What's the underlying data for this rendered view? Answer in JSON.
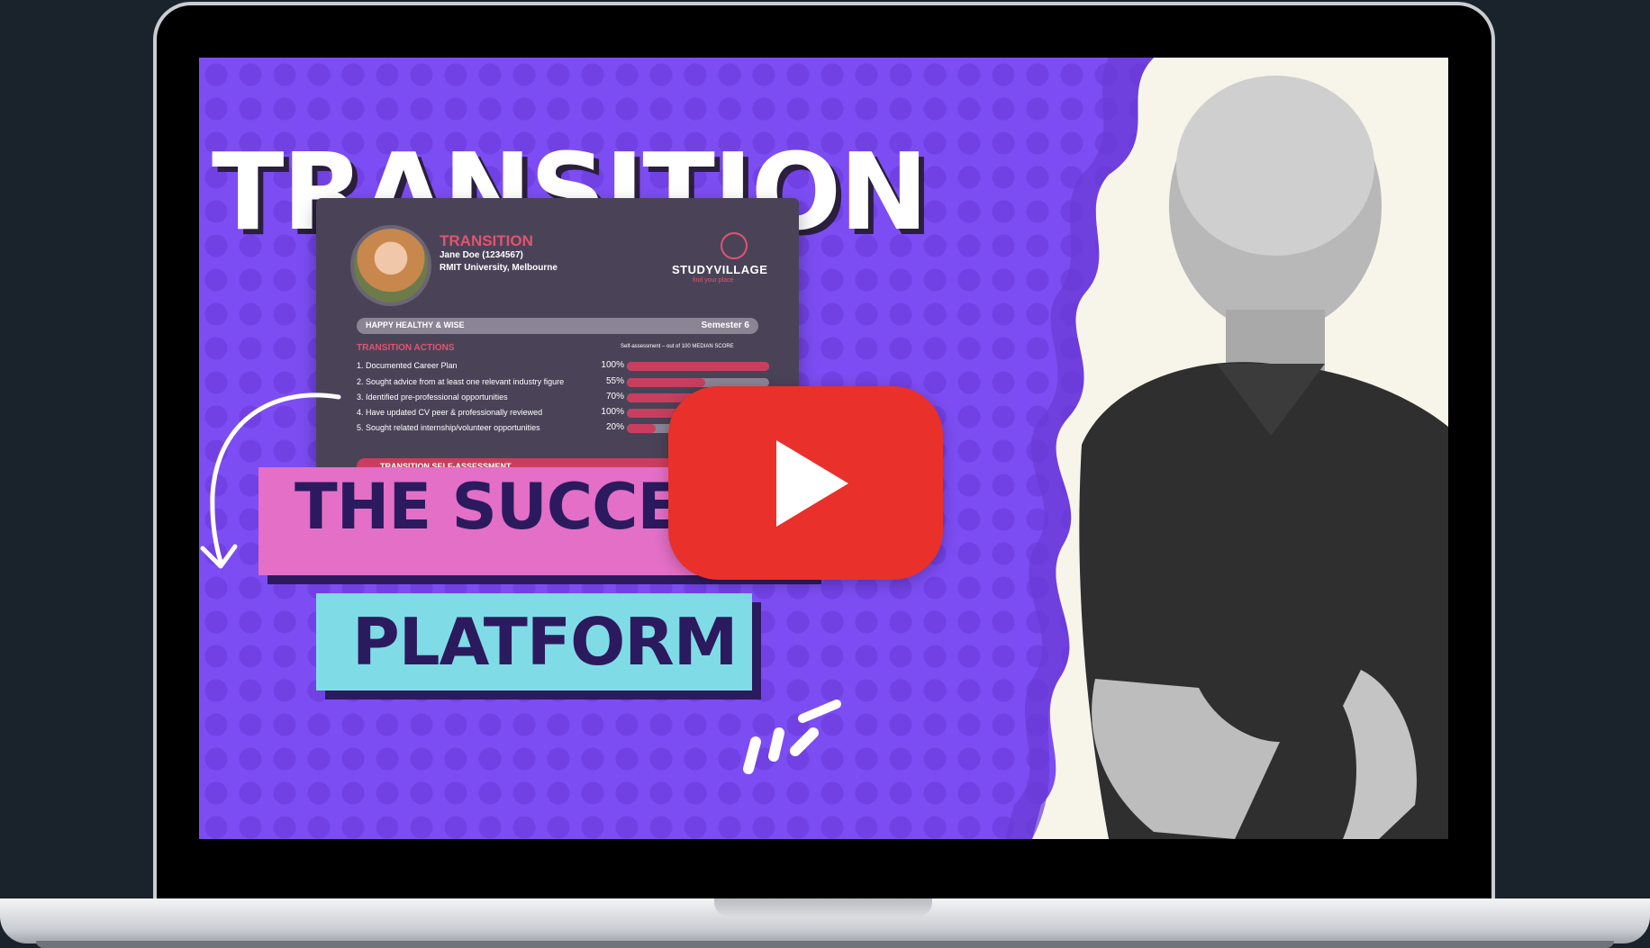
{
  "thumbnail": {
    "headline": "TRANSITION",
    "pink_label": "THE SUCCE",
    "cyan_label": "PLATFORM",
    "colors": {
      "background": "#7c4df2",
      "pink": "#e36fc7",
      "cyan": "#7fdce6",
      "dark_text": "#2c1a5e",
      "play_red": "#e9302a"
    }
  },
  "dashboard": {
    "title": "TRANSITION",
    "student_name": "Jane Doe (1234567)",
    "university": "RMIT University, Melbourne",
    "logo": "STUDYVILLAGE",
    "tagline": "find your place",
    "band_left": "HAPPY HEALTHY & WISE",
    "band_right": "Semester 6",
    "section_title": "TRANSITION ACTIONS",
    "legend": "Self-assessment – out of 100",
    "legend_median": "MEDIAN SCORE",
    "footer": "TRANSITION SELF-ASSESSMENT",
    "actions": [
      {
        "label": "1. Documented Career Plan",
        "percent_text": "100%",
        "value": 100
      },
      {
        "label": "2. Sought advice from at least one relevant industry figure",
        "percent_text": "55%",
        "value": 55
      },
      {
        "label": "3. Identified pre-professional opportunities",
        "percent_text": "70%",
        "value": 70
      },
      {
        "label": "4. Have updated CV peer & professionally reviewed",
        "percent_text": "100%",
        "value": 100
      },
      {
        "label": "5. Sought related internship/volunteer opportunities",
        "percent_text": "20%",
        "value": 20
      }
    ]
  },
  "video": {
    "play_icon": "play-icon"
  }
}
